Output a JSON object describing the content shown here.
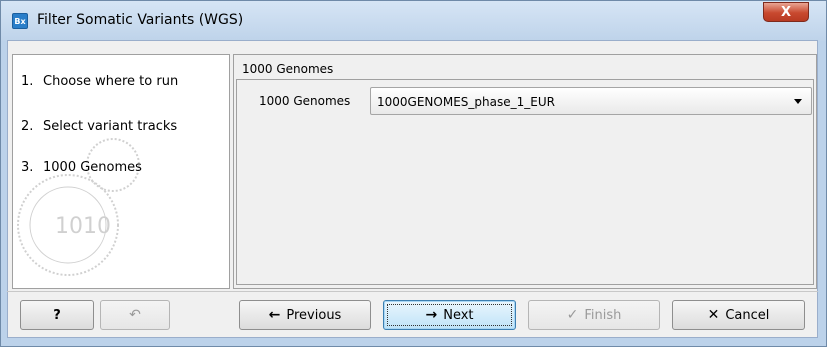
{
  "window": {
    "title": "Filter Somatic Variants (WGS)",
    "app_icon_text": "Bx",
    "close_symbol": "X"
  },
  "steps": [
    {
      "num": "1.",
      "label": "Choose where to run"
    },
    {
      "num": "2.",
      "label": "Select variant tracks"
    },
    {
      "num": "3.",
      "label": "1000 Genomes"
    }
  ],
  "panel": {
    "header": "1000 Genomes",
    "field_label": "1000 Genomes",
    "field_value": "1000GENOMES_phase_1_EUR"
  },
  "buttons": {
    "help": "?",
    "reset_icon": "↶",
    "previous": "Previous",
    "previous_icon": "←",
    "next": "Next",
    "next_icon": "→",
    "finish": "Finish",
    "finish_icon": "✓",
    "cancel": "Cancel",
    "cancel_icon": "✕"
  },
  "colors": {
    "title_bar": "#bed3ea",
    "close_button": "#c8492f",
    "default_button": "#bfe3f8"
  }
}
